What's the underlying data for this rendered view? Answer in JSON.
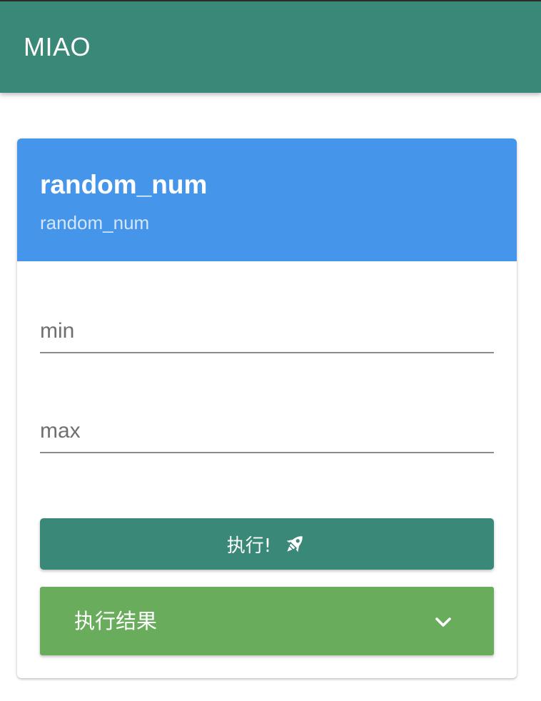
{
  "app": {
    "title": "MIAO",
    "color": "#3a8878"
  },
  "card": {
    "title": "random_num",
    "subtitle": "random_num",
    "header_color": "#4595ea"
  },
  "form": {
    "fields": [
      {
        "name": "min",
        "placeholder": "min",
        "value": ""
      },
      {
        "name": "max",
        "placeholder": "max",
        "value": ""
      }
    ]
  },
  "actions": {
    "run_label": "执行!",
    "run_icon": "rocket-icon"
  },
  "result": {
    "title": "执行结果",
    "icon": "chevron-down-icon",
    "color": "#69ad5c"
  }
}
